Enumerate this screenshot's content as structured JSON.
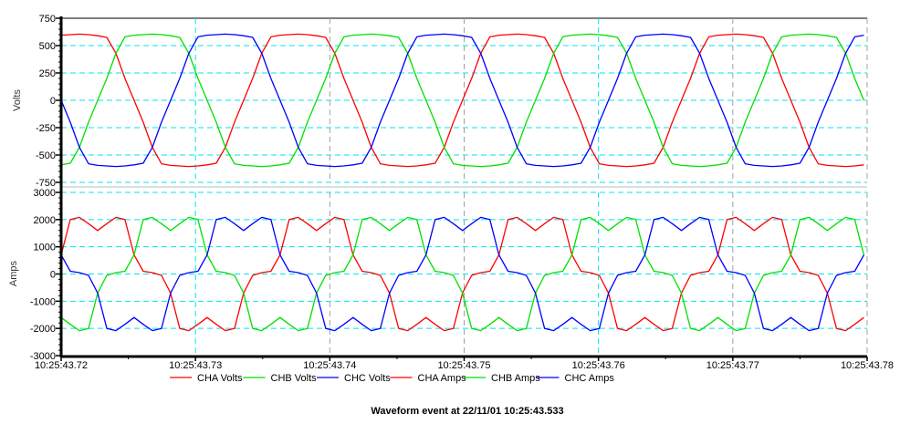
{
  "chart_data": [
    {
      "type": "line",
      "ylabel": "Volts",
      "ylim": [
        -750,
        750
      ],
      "yticks": [
        750,
        500,
        250,
        0,
        -250,
        -500,
        -750
      ],
      "xlim": [
        "10:25:43.72",
        "10:25:43.78"
      ],
      "grid": true,
      "x_start": "10:25:43.72",
      "sample_interval_s": 0.000679,
      "series": [
        {
          "name": "CHA Volts",
          "color": "#ff0000",
          "values": [
            595,
            600,
            605,
            600,
            590,
            575,
            430,
            200,
            0,
            -200,
            -430,
            -580,
            -595,
            -600,
            -605,
            -600,
            -590,
            -575,
            -430,
            -200,
            0,
            200,
            430,
            580,
            595,
            600,
            605,
            600,
            590,
            575,
            430,
            200,
            0,
            -200,
            -430,
            -580,
            -595,
            -600,
            -605,
            -600,
            -590,
            -575,
            -430,
            -200,
            0,
            200,
            430,
            580,
            595,
            600,
            605,
            600,
            590,
            575,
            430,
            200,
            0,
            -200,
            -430,
            -580,
            -595,
            -600,
            -605,
            -600,
            -590,
            -575,
            -430,
            -200,
            0,
            200,
            430,
            580,
            595,
            600,
            605,
            600,
            590,
            575,
            430,
            200,
            0,
            -200,
            -430,
            -580,
            -595,
            -600,
            -605,
            -600,
            -590
          ]
        },
        {
          "name": "CHB Volts",
          "color": "#00e000",
          "values": [
            -590,
            -575,
            -430,
            -200,
            0,
            200,
            430,
            580,
            595,
            600,
            605,
            600,
            590,
            575,
            430,
            200,
            0,
            -200,
            -430,
            -580,
            -595,
            -600,
            -605,
            -600,
            -590,
            -575,
            -430,
            -200,
            0,
            200,
            430,
            580,
            595,
            600,
            605,
            600,
            590,
            575,
            430,
            200,
            0,
            -200,
            -430,
            -580,
            -595,
            -600,
            -605,
            -600,
            -590,
            -575,
            -430,
            -200,
            0,
            200,
            430,
            580,
            595,
            600,
            605,
            600,
            590,
            575,
            430,
            200,
            0,
            -200,
            -430,
            -580,
            -595,
            -600,
            -605,
            -600,
            -590,
            -575,
            -430,
            -200,
            0,
            200,
            430,
            580,
            595,
            600,
            605,
            600,
            590,
            575,
            430,
            200,
            0
          ]
        },
        {
          "name": "CHC Volts",
          "color": "#0000ff",
          "values": [
            0,
            -200,
            -430,
            -580,
            -595,
            -600,
            -605,
            -600,
            -590,
            -575,
            -430,
            -200,
            0,
            200,
            430,
            580,
            595,
            600,
            605,
            600,
            590,
            575,
            430,
            200,
            0,
            -200,
            -430,
            -580,
            -595,
            -600,
            -605,
            -600,
            -590,
            -575,
            -430,
            -200,
            0,
            200,
            430,
            580,
            595,
            600,
            605,
            600,
            590,
            575,
            430,
            200,
            0,
            -200,
            -430,
            -580,
            -595,
            -600,
            -605,
            -600,
            -590,
            -575,
            -430,
            -200,
            0,
            200,
            430,
            580,
            595,
            600,
            605,
            600,
            590,
            575,
            430,
            200,
            0,
            -200,
            -430,
            -580,
            -595,
            -600,
            -605,
            -600,
            -590,
            -575,
            -430,
            -200,
            0,
            200,
            430,
            580,
            595
          ]
        }
      ]
    },
    {
      "type": "line",
      "ylabel": "Amps",
      "ylim": [
        -3000,
        3000
      ],
      "yticks": [
        3000,
        2000,
        1000,
        0,
        -1000,
        -2000,
        -3000
      ],
      "xlim": [
        "10:25:43.72",
        "10:25:43.78"
      ],
      "xticks": [
        "10:25:43.72",
        "10:25:43.73",
        "10:25:43.74",
        "10:25:43.75",
        "10:25:43.76",
        "10:25:43.77",
        "10:25:43.78"
      ],
      "grid": true,
      "x_start": "10:25:43.72",
      "sample_interval_s": 0.000679,
      "series": [
        {
          "name": "CHA Amps",
          "color": "#ff0000",
          "values": [
            700,
            2000,
            2080,
            1850,
            1600,
            1850,
            2080,
            2000,
            700,
            100,
            50,
            -50,
            -700,
            -2000,
            -2080,
            -1850,
            -1600,
            -1850,
            -2080,
            -2000,
            -700,
            -50,
            50,
            100,
            700,
            2000,
            2080,
            1850,
            1600,
            1850,
            2080,
            2000,
            700,
            100,
            50,
            -50,
            -700,
            -2000,
            -2080,
            -1850,
            -1600,
            -1850,
            -2080,
            -2000,
            -700,
            -50,
            50,
            100,
            700,
            2000,
            2080,
            1850,
            1600,
            1850,
            2080,
            2000,
            700,
            100,
            50,
            -50,
            -700,
            -2000,
            -2080,
            -1850,
            -1600,
            -1850,
            -2080,
            -2000,
            -700,
            -50,
            50,
            100,
            700,
            2000,
            2080,
            1850,
            1600,
            1850,
            2080,
            2000,
            700,
            100,
            50,
            -50,
            -700,
            -2000,
            -2080,
            -1850,
            -1600
          ]
        },
        {
          "name": "CHB Amps",
          "color": "#00e000",
          "values": [
            -1600,
            -1850,
            -2080,
            -2000,
            -700,
            -50,
            50,
            100,
            700,
            2000,
            2080,
            1850,
            1600,
            1850,
            2080,
            2000,
            700,
            100,
            50,
            -50,
            -700,
            -2000,
            -2080,
            -1850,
            -1600,
            -1850,
            -2080,
            -2000,
            -700,
            -50,
            50,
            100,
            700,
            2000,
            2080,
            1850,
            1600,
            1850,
            2080,
            2000,
            700,
            100,
            50,
            -50,
            -700,
            -2000,
            -2080,
            -1850,
            -1600,
            -1850,
            -2080,
            -2000,
            -700,
            -50,
            50,
            100,
            700,
            2000,
            2080,
            1850,
            1600,
            1850,
            2080,
            2000,
            700,
            100,
            50,
            -50,
            -700,
            -2000,
            -2080,
            -1850,
            -1600,
            -1850,
            -2080,
            -2000,
            -700,
            -50,
            50,
            100,
            700,
            2000,
            2080,
            1850,
            1600,
            1850,
            2080,
            2000,
            700
          ]
        },
        {
          "name": "CHC Amps",
          "color": "#0000ff",
          "values": [
            700,
            100,
            50,
            -50,
            -700,
            -2000,
            -2080,
            -1850,
            -1600,
            -1850,
            -2080,
            -2000,
            -700,
            -50,
            50,
            100,
            700,
            2000,
            2080,
            1850,
            1600,
            1850,
            2080,
            2000,
            700,
            100,
            50,
            -50,
            -700,
            -2000,
            -2080,
            -1850,
            -1600,
            -1850,
            -2080,
            -2000,
            -700,
            -50,
            50,
            100,
            700,
            2000,
            2080,
            1850,
            1600,
            1850,
            2080,
            2000,
            700,
            100,
            50,
            -50,
            -700,
            -2000,
            -2080,
            -1850,
            -1600,
            -1850,
            -2080,
            -2000,
            -700,
            -50,
            50,
            100,
            700,
            2000,
            2080,
            1850,
            1600,
            1850,
            2080,
            2000,
            700,
            100,
            50,
            -50,
            -700,
            -2000,
            -2080,
            -1850,
            -1600,
            -1850,
            -2080,
            -2000,
            -700,
            -50,
            50,
            100,
            700
          ]
        }
      ]
    }
  ],
  "legend": {
    "placement": "bottom",
    "entries": [
      {
        "label": "CHA Volts",
        "color": "#ff0000"
      },
      {
        "label": "CHB Volts",
        "color": "#00e000"
      },
      {
        "label": "CHC Volts",
        "color": "#0000ff"
      },
      {
        "label": "CHA Amps",
        "color": "#ff0000"
      },
      {
        "label": "CHB Amps",
        "color": "#00e000"
      },
      {
        "label": "CHC Amps",
        "color": "#0000ff"
      }
    ]
  },
  "title": "Waveform event at 22/11/01 10:25:43.533",
  "colors": {
    "grid_major": "#00e5ee",
    "grid_minor": "#a0a0a0",
    "axis": "#000000"
  }
}
